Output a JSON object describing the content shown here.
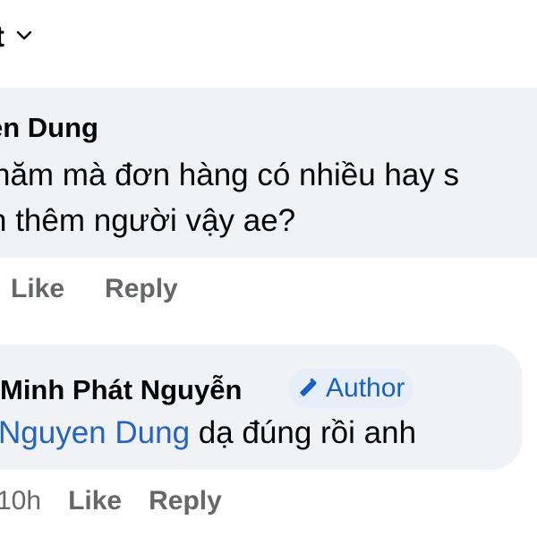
{
  "sort": {
    "label": "t",
    "icon": "chevron-down-icon"
  },
  "comments": [
    {
      "author": "en Dung",
      "text_lines": [
        "năm mà đơn hàng có nhiều hay s",
        "n thêm người vậy ae?"
      ],
      "actions": {
        "like": "Like",
        "reply": "Reply"
      }
    },
    {
      "author": "Minh Phát Nguyễn",
      "badge": {
        "label": "Author",
        "icon": "pencil-icon"
      },
      "mention": "Nguyen Dung",
      "text": " dạ đúng rồi anh",
      "time": "10h",
      "actions": {
        "like": "Like",
        "reply": "Reply"
      }
    }
  ],
  "colors": {
    "bubble": "#f0f2f5",
    "mention": "#2463c4",
    "badge_text": "#1760c4",
    "badge_bg": "#e7eef9",
    "muted": "#65676b"
  }
}
